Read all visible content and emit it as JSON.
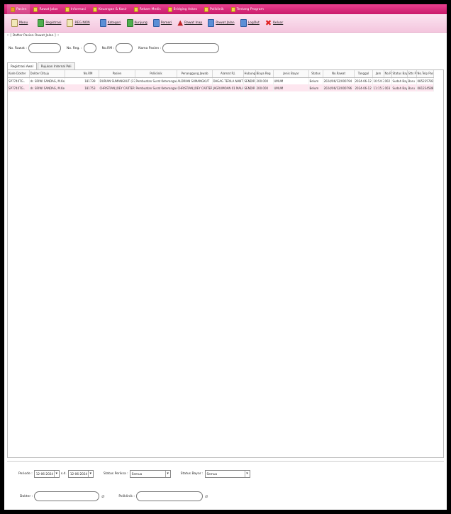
{
  "menubar": {
    "items": [
      {
        "label": "Pasien",
        "icon": "folder-icon"
      },
      {
        "label": "Rawat Jalan",
        "icon": "folder-icon"
      },
      {
        "label": "Informasi",
        "icon": "folder-icon"
      },
      {
        "label": "Keuangan & Kasir",
        "icon": "folder-icon"
      },
      {
        "label": "Rekam Medis",
        "icon": "folder-icon"
      },
      {
        "label": "Bridging Askes",
        "icon": "folder-icon"
      },
      {
        "label": "Poliklinik",
        "icon": "folder-icon"
      },
      {
        "label": "Tentang Program",
        "icon": "info-icon"
      }
    ]
  },
  "toolbar": {
    "items": [
      {
        "label": "Menu",
        "icon": "menu-icon"
      },
      {
        "label": "Registrasi",
        "icon": "registration-icon"
      },
      {
        "label": "REG.NON",
        "icon": "reg-non-icon"
      },
      {
        "label": "Kategori",
        "icon": "category-icon"
      },
      {
        "label": "Kunjung",
        "icon": "visit-icon"
      },
      {
        "label": "Pemeri",
        "icon": "examine-icon"
      },
      {
        "label": "Rawat Inap",
        "icon": "inpatient-icon"
      },
      {
        "label": "Rawat Jalan",
        "icon": "outpatient-icon"
      },
      {
        "label": "LogOut",
        "icon": "logout-icon"
      },
      {
        "label": "Keluar",
        "icon": "exit-icon"
      }
    ]
  },
  "subtitle": ":: [ Daftar Pasien Rawat Jalan ] ::",
  "filter": {
    "no_rawat_label": "No. Rawat :",
    "no_reg_label": "No. Reg. :",
    "no_rm_label": "No.RM :",
    "nama_pasien_label": "Nama Pasien :"
  },
  "tabs": [
    {
      "label": "Registrasi Awal",
      "active": true
    },
    {
      "label": "Rujukan Internal Poli",
      "active": false
    }
  ],
  "table": {
    "columns": [
      "Kode Dokter",
      "Dokter Dituju",
      "No.RM",
      "Pasien",
      "Poliklinik",
      "Penanggung Jawab",
      "Alamat P.J.",
      "Hubungan P.J.",
      "Biaya Reg",
      "Jenis Bayar",
      "Status",
      "No.Rawat",
      "Tanggal",
      "Jam",
      "No.Reg",
      "Status Bayar",
      "Stts Poli",
      "No.Telp Pasien"
    ],
    "rows": [
      [
        "SP7740TG..",
        "dr. SRIWI SANDAG, M.Kes",
        "181739",
        "DURIAN SUMANGKUT (37 TH)",
        "Pembuatan Surat Keterangan Bebas..",
        "ALDRIAN SUMANGKUT",
        "DAGAG TERILA NANTOLOG..",
        "SENDIRI",
        "200.000",
        "UMUM",
        "",
        "Belum",
        "2024/06/12/000794",
        "2024-06-12",
        "10:54:34",
        "002",
        "Sudah Bayar",
        "Baru",
        "085235782511"
      ],
      [
        "SP7740TG..",
        "dr. SRIWI SANDAG, M.Kes",
        "181753",
        "CHRISTIAN JOEY CARTERBU..",
        "Pembuatan Surat Keterangan Bebas..",
        "CHRISTIAN JOEY CARTERBU..",
        "JAGRUMOAN 01 MALALAYANA..",
        "SENDIRI",
        "200.000",
        "UMUM",
        "",
        "Belum",
        "2024/06/12/000796",
        "2024-06-12",
        "11:15:20",
        "003",
        "Sudah Bayar",
        "Baru",
        "081234588457"
      ]
    ]
  },
  "bottom": {
    "periode_label": "Periode :",
    "date_from": "12-06-2024",
    "sd_label": "s.d.",
    "date_to": "12-06-2024",
    "status_periksa_label": "Status Periksa :",
    "status_periksa_value": "Semua",
    "status_bayar_label": "Status Bayar :",
    "status_bayar_value": "Semua",
    "dokter_label": "Dokter :",
    "poliklinik_label": "Poliklinik :"
  }
}
